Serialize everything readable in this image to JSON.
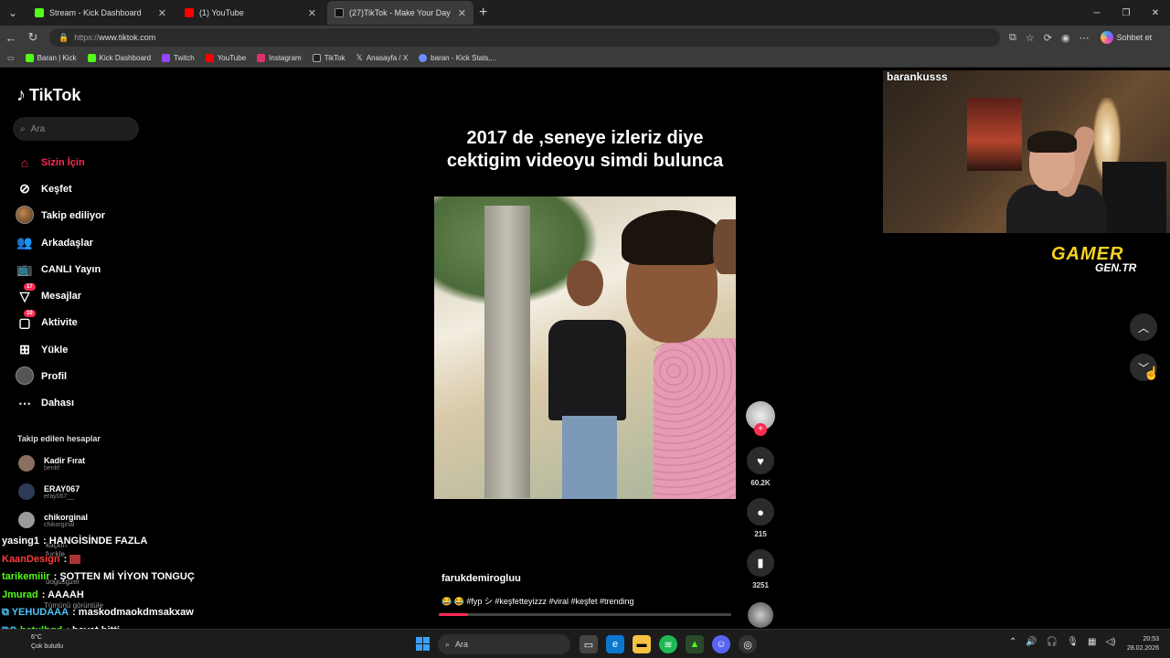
{
  "browser": {
    "tabs": [
      {
        "label": "Stream - Kick Dashboard",
        "color": "#53fc18",
        "active": false
      },
      {
        "label": "(1) YouTube",
        "color": "#ff0000",
        "active": false
      },
      {
        "label": "(27)TikTok - Make Your Day",
        "color": "#ffffff",
        "active": true
      }
    ],
    "url_proto": "https://",
    "url_host": "www.tiktok.com",
    "chat_button": "Sohbet et",
    "bookmarks": [
      {
        "label": "Baran | Kick",
        "color": "#53fc18"
      },
      {
        "label": "Kick Dashboard",
        "color": "#53fc18"
      },
      {
        "label": "Twitch",
        "color": "#9146ff"
      },
      {
        "label": "YouTube",
        "color": "#ff0000"
      },
      {
        "label": "Instagram",
        "color": "#e1306c"
      },
      {
        "label": "TikTok",
        "color": "#ffffff"
      },
      {
        "label": "Anasayfa / X",
        "color": "#ffffff"
      },
      {
        "label": "baran - Kick Stats,...",
        "color": "#6e8cff"
      }
    ]
  },
  "tiktok": {
    "logo": "TikTok",
    "search_placeholder": "Ara",
    "nav": [
      {
        "label": "Sizin İçin",
        "icon": "home-icon",
        "active": true
      },
      {
        "label": "Keşfet",
        "icon": "compass-icon"
      },
      {
        "label": "Takip ediliyor",
        "icon": "avatar"
      },
      {
        "label": "Arkadaşlar",
        "icon": "friends-icon"
      },
      {
        "label": "CANLI Yayın",
        "icon": "live-icon"
      },
      {
        "label": "Mesajlar",
        "icon": "message-icon",
        "badge": "17"
      },
      {
        "label": "Aktivite",
        "icon": "activity-icon",
        "badge": "10"
      },
      {
        "label": "Yükle",
        "icon": "upload-icon"
      },
      {
        "label": "Profil",
        "icon": "profile-icon"
      },
      {
        "label": "Dahası",
        "icon": "more-icon"
      }
    ],
    "following_title": "Takip edilen hesaplar",
    "following": [
      {
        "name": "Kadir Fırat",
        "handle": "benkf"
      },
      {
        "name": "ERAY067",
        "handle": "eray067__"
      },
      {
        "name": "chikorginal",
        "handle": "chikorginal"
      }
    ],
    "ghost_texts": [
      "kaçkın",
      "fuckle",
      "dogusgzer",
      "Tümünü görüntüle"
    ],
    "video": {
      "caption": "2017 de ,seneye izleriz diye cektigim videoyu simdi bulunca",
      "author": "farukdemirogluu",
      "description": "😂 😂 #fyp シ #keşfetteyizzz #viral #keşfet #trending",
      "progress_fraction": 0.1,
      "likes": "60.2K",
      "comments": "215",
      "saves": "3251"
    }
  },
  "stream_overlay": {
    "streamer": "barankusss",
    "brand_top": "GAMER",
    "brand_bottom": "GEN.TR",
    "chat": [
      {
        "user": "yasing1",
        "user_color": "#ffffff",
        "message": "HANGİSİNDE FAZLA"
      },
      {
        "user": "KaanDesign",
        "user_color": "#ff3b3b",
        "message": ""
      },
      {
        "user": "tarikemiiir",
        "user_color": "#53fc18",
        "message": "ŞOTTEN Mİ YİYON TONGUÇ"
      },
      {
        "user": "Jmurad",
        "user_color": "#53fc18",
        "message": "AAAAH"
      },
      {
        "user": "YEHUDAAA",
        "user_color": "#4fc3f7",
        "message": "maskodmaokdmsakxaw"
      },
      {
        "user": "betulbgd",
        "user_color": "#53fc18",
        "message": "hayat bitti"
      }
    ]
  },
  "taskbar": {
    "temperature": "6°C",
    "weather": "Çok bulutlu",
    "search": "Ara",
    "time": "20:53",
    "date": "28.02.2026"
  }
}
